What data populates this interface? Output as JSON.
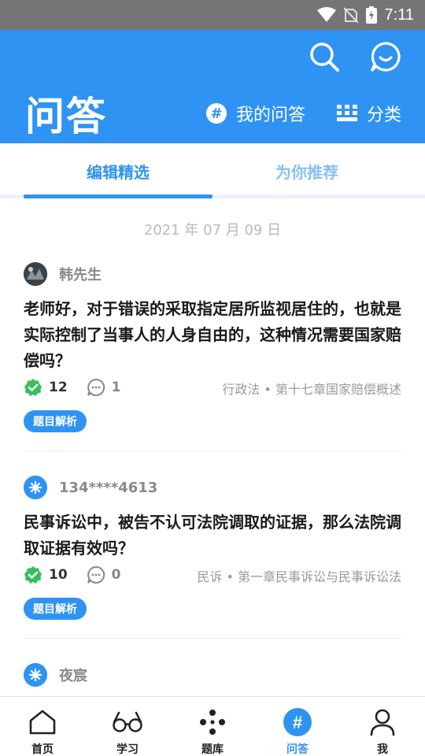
{
  "status_bar": {
    "time": "7:11",
    "icons": [
      "wifi-icon",
      "no-sim-icon",
      "battery-charging-icon"
    ]
  },
  "header": {
    "title": "问答",
    "my_questions_label": "我的问答",
    "category_label": "分类",
    "accent_color": "#2f93f3"
  },
  "tabs": [
    {
      "label": "编辑精选",
      "active": true
    },
    {
      "label": "为你推荐",
      "active": false
    }
  ],
  "date_label": "2021 年 07 月 09 日",
  "questions": [
    {
      "username": "韩先生",
      "question": "老师好，对于错误的采取指定居所监视居住的，也就是实际控制了当事人的人身自由的，这种情况需要国家赔偿吗？",
      "answers": "12",
      "comments": "1",
      "category": "行政法 • 第十七章国家赔偿概述",
      "tag": "题目解析"
    },
    {
      "username": "134****4613",
      "question": "民事诉讼中，被告不认可法院调取的证据，那么法院调取证据有效吗？",
      "answers": "10",
      "comments": "0",
      "category": "民诉 • 第一章民事诉讼与民事诉讼法",
      "tag": "题目解析"
    },
    {
      "username": "夜宸"
    }
  ],
  "bottom_nav": [
    {
      "label": "首页",
      "icon": "home-icon",
      "active": false
    },
    {
      "label": "学习",
      "icon": "glasses-icon",
      "active": false
    },
    {
      "label": "题库",
      "icon": "dots-icon",
      "active": false
    },
    {
      "label": "问答",
      "icon": "hash-icon",
      "active": true
    },
    {
      "label": "我",
      "icon": "person-icon",
      "active": false
    }
  ]
}
